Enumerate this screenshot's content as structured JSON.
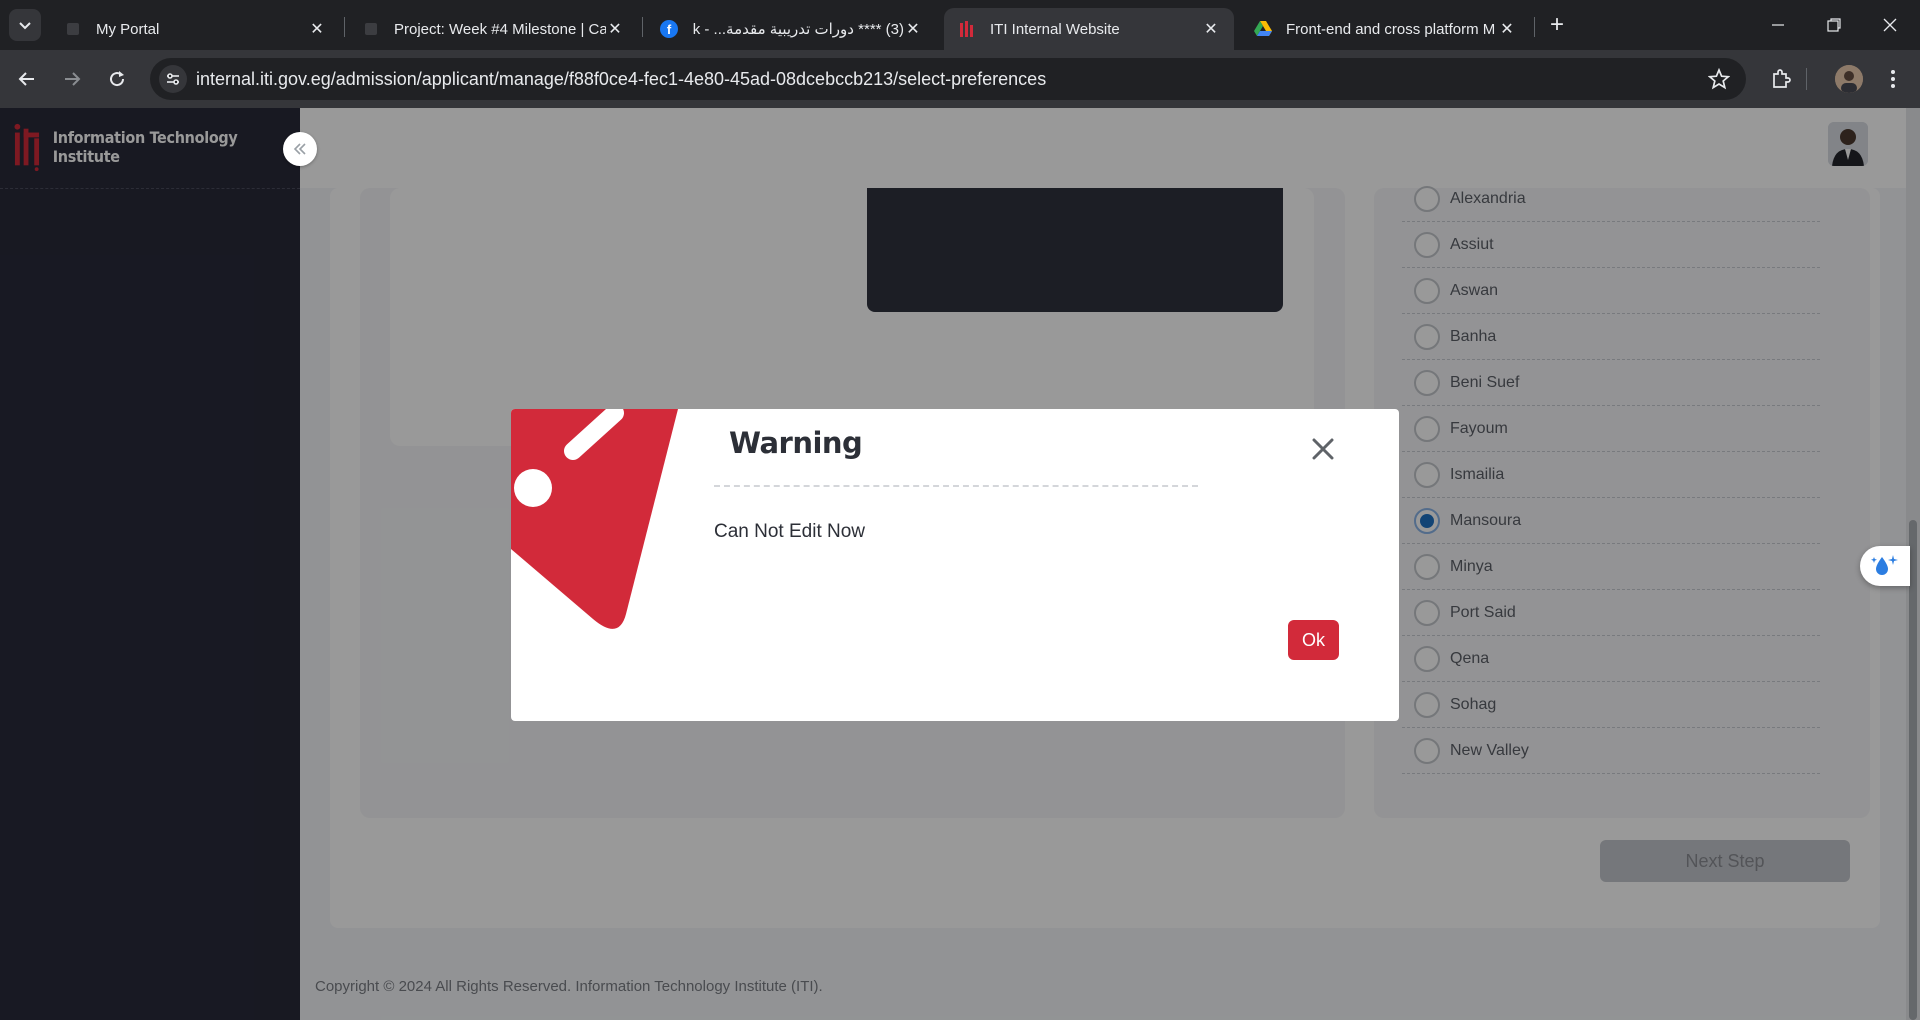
{
  "browser": {
    "tabs": [
      {
        "title": "My Portal",
        "favicon": "portal-icon"
      },
      {
        "title": "Project: Week #4 Milestone | Ca",
        "favicon": "portal-icon"
      },
      {
        "title": "(3) **** دورات تدريبية مقدمة... - k",
        "favicon": "facebook-icon"
      },
      {
        "title": "ITI Internal Website",
        "favicon": "iti-icon"
      },
      {
        "title": "Front-end and cross platform M",
        "favicon": "google-drive-icon"
      }
    ],
    "url": "internal.iti.gov.eg/admission/applicant/manage/f88f0ce4-fec1-4e80-45ad-08dcebccb213/select-preferences"
  },
  "sidebar": {
    "logo_text": "Information Technology Institute"
  },
  "governorates": [
    {
      "name": "Alexandria",
      "selected": false
    },
    {
      "name": "Assiut",
      "selected": false
    },
    {
      "name": "Aswan",
      "selected": false
    },
    {
      "name": "Banha",
      "selected": false
    },
    {
      "name": "Beni Suef",
      "selected": false
    },
    {
      "name": "Fayoum",
      "selected": false
    },
    {
      "name": "Ismailia",
      "selected": false
    },
    {
      "name": "Mansoura",
      "selected": true
    },
    {
      "name": "Minya",
      "selected": false
    },
    {
      "name": "Port Said",
      "selected": false
    },
    {
      "name": "Qena",
      "selected": false
    },
    {
      "name": "Sohag",
      "selected": false
    },
    {
      "name": "New Valley",
      "selected": false
    }
  ],
  "next_button_label": "Next Step",
  "footer": {
    "text": "Copyright © 2024 All Rights Reserved. Information Technology Institute (ITI)."
  },
  "modal": {
    "title": "Warning",
    "message": "Can Not Edit Now",
    "ok_label": "Ok"
  },
  "colors": {
    "accent_red": "#d22a3a",
    "sidebar_dark": "#282a3a",
    "radio_checked": "#1f72c4"
  }
}
